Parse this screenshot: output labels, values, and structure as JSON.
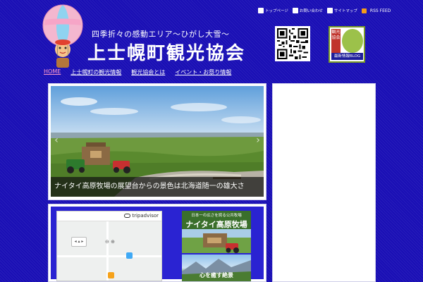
{
  "header": {
    "tagline": "四季折々の感動エリア〜ひがし大雪〜",
    "title": "上士幌町観光協会",
    "top_links": [
      {
        "icon": "home-icon",
        "label": "トップページ"
      },
      {
        "icon": "mail-icon",
        "label": "お問い合わせ"
      },
      {
        "icon": "sitemap-icon",
        "label": "サイトマップ"
      }
    ],
    "rss_label": "RSS FEED",
    "blog_badge": {
      "left_text": "観光協会",
      "bottom_text": "最新情報BLOG"
    }
  },
  "nav": {
    "items": [
      {
        "label": "HOME",
        "active": true
      },
      {
        "label": "上士幌町の観光情報"
      },
      {
        "label": "観光協会とは"
      },
      {
        "label": "イベント・お祭り情報"
      }
    ]
  },
  "slider": {
    "caption": "ナイタイ高原牧場の展望台からの景色は北海道随一の雄大さ"
  },
  "map_widget": {
    "brand": "tripadvisor"
  },
  "ads": {
    "ranch_subtitle": "日本一の広さを誇る公共牧場",
    "ranch_title": "ナイタイ高原牧場",
    "mountain_title": "心を癒す絶景"
  },
  "colors": {
    "background": "#1a0fb5",
    "nav_active": "#ff9acb",
    "panel": "#ffffff"
  }
}
